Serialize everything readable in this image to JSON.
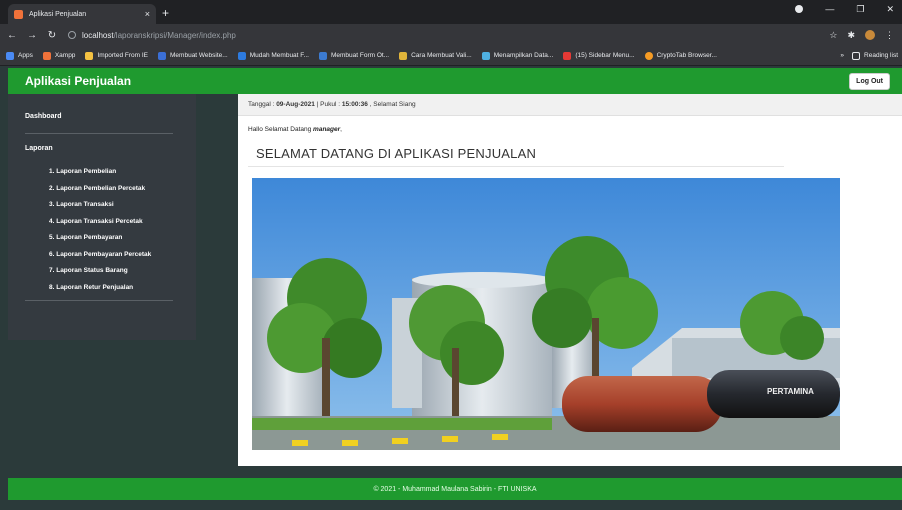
{
  "browser": {
    "tab_title": "Aplikasi Penjualan",
    "tab_close": "×",
    "new_tab": "+",
    "url_host": "localhost",
    "url_path": "/laporanskripsi/Manager/index.php",
    "bookmarks": [
      "Apps",
      "Xampp",
      "Imported From IE",
      "Membuat Website...",
      "Mudah Membuat F...",
      "Membuat Form Ot...",
      "Cara Membuat Vali...",
      "Menampilkan Data...",
      "(15) Sidebar Menu...",
      "CryptoTab Browser..."
    ],
    "bookmarks_more": "»",
    "reading_list": "Reading list",
    "colors": {
      "chrome_dark": "#202124",
      "chrome": "#35363a"
    }
  },
  "header": {
    "title": "Aplikasi Penjualan",
    "logout": "Log Out",
    "color": "#1f9a2f"
  },
  "sidebar": {
    "dashboard": "Dashboard",
    "laporan": "Laporan",
    "items": [
      "1. Laporan Pembelian",
      "2. Laporan Pembelian Percetak",
      "3. Laporan Transaksi",
      "4. Laporan Transaksi Percetak",
      "5. Laporan Pembayaran",
      "6. Laporan Pembayaran Percetak",
      "7. Laporan Status Barang",
      "8. Laporan Retur Penjualan"
    ]
  },
  "main": {
    "date_label": "Tanggal : ",
    "date_value": "09-Aug-2021",
    "time_label": " | Pukul : ",
    "time_value": "15:00:36",
    "greeting_time": " , Selamat Siang",
    "hello_prefix": "Hallo Selamat Datang ",
    "hello_user": "manager",
    "hello_suffix": ",",
    "welcome": "SELAMAT DATANG DI APLIKASI PENJUALAN",
    "truck_brand": "PERTAMINA"
  },
  "footer": {
    "text": "© 2021 - Muhammad Maulana Sabirin - FTI UNISKA"
  }
}
